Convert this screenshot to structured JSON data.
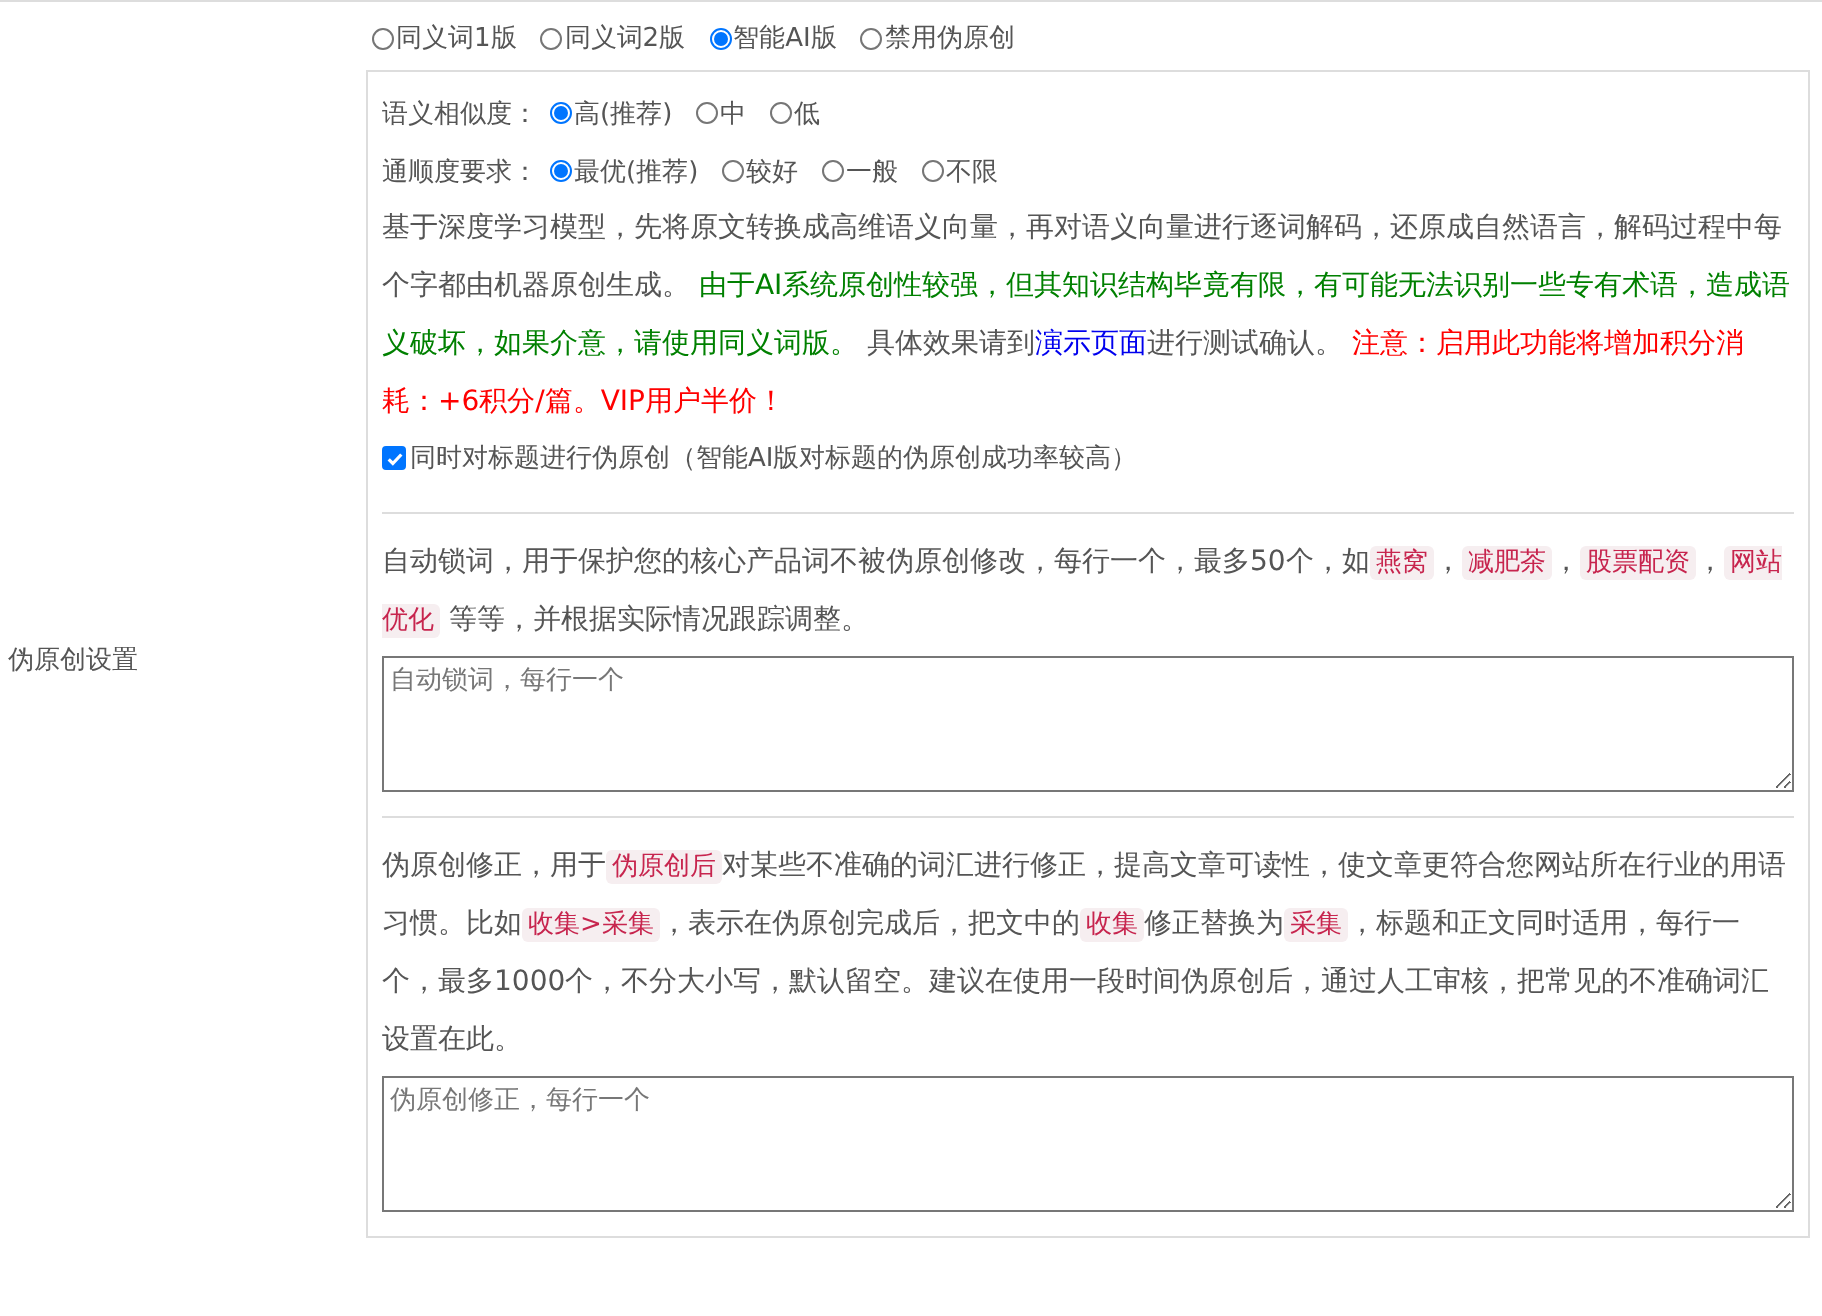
{
  "side_label": "伪原创设置",
  "modes": [
    {
      "label": "同义词1版",
      "selected": false
    },
    {
      "label": "同义词2版",
      "selected": false
    },
    {
      "label": "智能AI版",
      "selected": true
    },
    {
      "label": "禁用伪原创",
      "selected": false
    }
  ],
  "ai_settings": {
    "similarity": {
      "label": "语义相似度：",
      "options": [
        {
          "label": "高(推荐)",
          "selected": true
        },
        {
          "label": "中",
          "selected": false
        },
        {
          "label": "低",
          "selected": false
        }
      ]
    },
    "fluency": {
      "label": "通顺度要求：",
      "options": [
        {
          "label": "最优(推荐)",
          "selected": true
        },
        {
          "label": "较好",
          "selected": false
        },
        {
          "label": "一般",
          "selected": false
        },
        {
          "label": "不限",
          "selected": false
        }
      ]
    },
    "description": [
      {
        "kind": "plain",
        "text": "基于深度学习模型，先将原文转换成高维语义向量，再对语义向量进行逐词解码，还原成自然语言，解码过程中每个字都由机器原创生成。 "
      },
      {
        "kind": "green",
        "text": "由于AI系统原创性较强，但其知识结构毕竟有限，有可能无法识别一些专有术语，造成语义破坏，如果介意，请使用同义词版。"
      },
      {
        "kind": "plain",
        "text": " 具体效果请到"
      },
      {
        "kind": "link",
        "text": "演示页面"
      },
      {
        "kind": "plain",
        "text": "进行测试确认。 "
      },
      {
        "kind": "red",
        "text": "注意：启用此功能将增加积分消耗：+6积分/篇。VIP用户半价！"
      }
    ],
    "title_option": {
      "label": "同时对标题进行伪原创（智能AI版对标题的伪原创成功率较高）",
      "checked": true
    }
  },
  "lock_words": {
    "segments": [
      {
        "kind": "text",
        "text": "自动锁词，用于保护您的核心产品词不被伪原创修改，每行一个，最多50个，如"
      },
      {
        "kind": "tag",
        "text": "燕窝"
      },
      {
        "kind": "text",
        "text": "，"
      },
      {
        "kind": "tag",
        "text": "减肥茶"
      },
      {
        "kind": "text",
        "text": "，"
      },
      {
        "kind": "tag",
        "text": "股票配资"
      },
      {
        "kind": "text",
        "text": "，"
      },
      {
        "kind": "tag",
        "text": "网站优化"
      },
      {
        "kind": "text",
        "text": " 等等，并根据实际情况跟踪调整。"
      }
    ],
    "placeholder": "自动锁词，每行一个"
  },
  "corrections": {
    "segments": [
      {
        "kind": "text",
        "text": "伪原创修正，用于"
      },
      {
        "kind": "tag",
        "text": "伪原创后"
      },
      {
        "kind": "text",
        "text": "对某些不准确的词汇进行修正，提高文章可读性，使文章更符合您网站所在行业的用语习惯。比如"
      },
      {
        "kind": "tag",
        "text": "收集>采集"
      },
      {
        "kind": "text",
        "text": "，表示在伪原创完成后，把文中的"
      },
      {
        "kind": "tag",
        "text": "收集"
      },
      {
        "kind": "text",
        "text": "修正替换为"
      },
      {
        "kind": "tag",
        "text": "采集"
      },
      {
        "kind": "text",
        "text": "，标题和正文同时适用，每行一个，最多1000个，不分大小写，默认留空。建议在使用一段时间伪原创后，通过人工审核，把常见的不准确词汇设置在此。"
      }
    ],
    "placeholder": "伪原创修正，每行一个"
  }
}
